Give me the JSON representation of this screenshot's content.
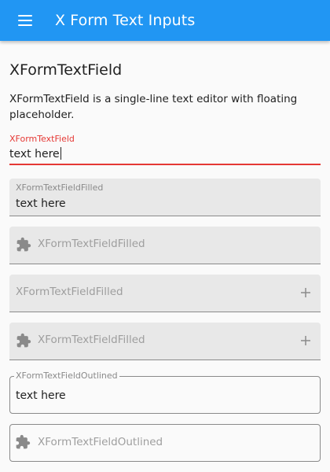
{
  "appbar": {
    "title": "X Form Text Inputs",
    "menu_icon": "hamburger-menu-icon",
    "background_color": "#2196f3"
  },
  "section": {
    "heading": "XFormTextField",
    "description": "XFormTextField is a single-line text editor with floating placeholder."
  },
  "fields": {
    "plain": {
      "label": "XFormTextField",
      "value": "text here",
      "accent_color": "#e53935"
    },
    "filled1": {
      "label": "XFormTextFieldFilled",
      "value": "text here"
    },
    "filled2": {
      "placeholder": "XFormTextFieldFilled",
      "leading_icon": "puzzle-piece-icon"
    },
    "filled3": {
      "placeholder": "XFormTextFieldFilled",
      "trailing_icon": "plus-icon"
    },
    "filled4": {
      "placeholder": "XFormTextFieldFilled",
      "leading_icon": "puzzle-piece-icon",
      "trailing_icon": "plus-icon"
    },
    "outlined1": {
      "label": "XFormTextFieldOutlined",
      "value": "text here"
    },
    "outlined2": {
      "placeholder": "XFormTextFieldOutlined",
      "leading_icon": "puzzle-piece-icon"
    }
  }
}
